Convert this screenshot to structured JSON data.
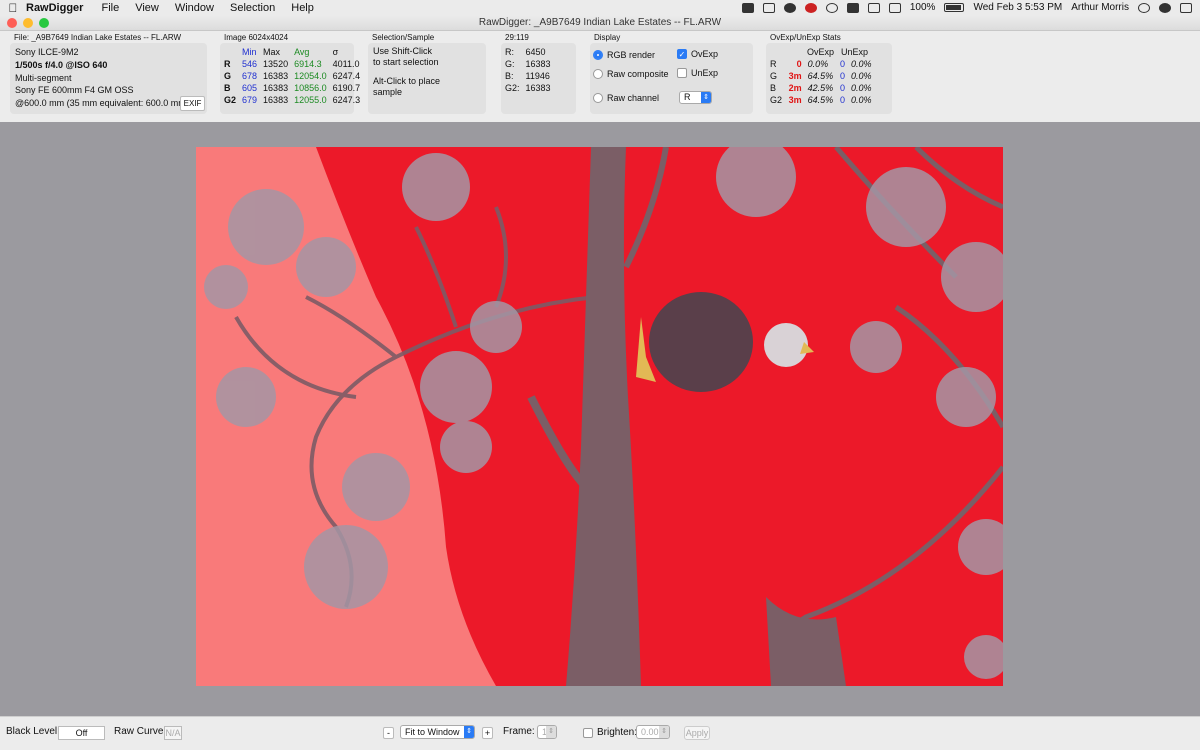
{
  "menubar": {
    "apple": "",
    "app": "RawDigger",
    "items": [
      "File",
      "View",
      "Window",
      "Selection",
      "Help"
    ],
    "battery": "100%",
    "datetime": "Wed Feb 3  5:53 PM",
    "user": "Arthur Morris"
  },
  "window": {
    "title": "RawDigger: _A9B7649  Indian Lake Estates -- FL.ARW"
  },
  "file": {
    "label": "File: _A9B7649  Indian Lake Estates -- FL.ARW",
    "camera": "Sony ILCE-9M2",
    "exposure": "1/500s f/4.0 @ISO 640",
    "mode": "Multi-segment",
    "lens": "Sony FE 600mm F4 GM OSS",
    "focal": "@600.0 mm (35 mm equivalent: 600.0 mm)",
    "exif_button": "EXIF"
  },
  "image_stats": {
    "label": "Image 6024x4024",
    "headers": [
      "",
      "Min",
      "Max",
      "Avg",
      "σ"
    ],
    "rows": [
      {
        "ch": "R",
        "min": "546",
        "max": "13520",
        "avg": "6914.3",
        "sigma": "4011.0"
      },
      {
        "ch": "G",
        "min": "678",
        "max": "16383",
        "avg": "12054.0",
        "sigma": "6247.4"
      },
      {
        "ch": "B",
        "min": "605",
        "max": "16383",
        "avg": "10856.0",
        "sigma": "6190.7"
      },
      {
        "ch": "G2",
        "min": "679",
        "max": "16383",
        "avg": "12055.0",
        "sigma": "6247.3"
      }
    ]
  },
  "selection": {
    "label": "Selection/Sample",
    "line1": "Use Shift-Click",
    "line2": "to start selection",
    "line3": "Alt-Click to place",
    "line4": "sample"
  },
  "sample": {
    "label": "29:119",
    "rows": [
      {
        "ch": "R:",
        "val": "6450"
      },
      {
        "ch": "G:",
        "val": "16383"
      },
      {
        "ch": "B:",
        "val": "11946"
      },
      {
        "ch": "G2:",
        "val": "16383"
      }
    ]
  },
  "display": {
    "label": "Display",
    "rgb_render": "RGB render",
    "raw_composite": "Raw composite",
    "raw_channel": "Raw channel",
    "ovexp": "OvExp",
    "unexp": "UnExp",
    "channel_value": "R",
    "selected_mode": "RGB render",
    "ovexp_checked": true,
    "unexp_checked": false
  },
  "ovexp_stats": {
    "label": "OvExp/UnExp Stats",
    "headers": [
      "",
      "OvExp",
      "",
      "UnExp",
      ""
    ],
    "rows": [
      {
        "ch": "R",
        "ov_count": "0",
        "ov_pct": "0.0%",
        "un_count": "0",
        "un_pct": "0.0%"
      },
      {
        "ch": "G",
        "ov_count": "3m",
        "ov_pct": "64.5%",
        "un_count": "0",
        "un_pct": "0.0%"
      },
      {
        "ch": "B",
        "ov_count": "2m",
        "ov_pct": "42.5%",
        "un_count": "0",
        "un_pct": "0.0%"
      },
      {
        "ch": "G2",
        "ov_count": "3m",
        "ov_pct": "64.5%",
        "un_count": "0",
        "un_pct": "0.0%"
      }
    ]
  },
  "bottom": {
    "black_level_label": "Black Level:",
    "black_level_value": "Off",
    "raw_curve_label": "Raw Curve:",
    "raw_curve_value": "N/A",
    "zoom_minus": "-",
    "zoom_value": "Fit to Window",
    "zoom_plus": "+",
    "frame_label": "Frame:",
    "frame_value": "1",
    "brighten_label": "Brighten:",
    "brighten_value": "0.00",
    "apply_label": "Apply"
  },
  "colors": {
    "overexposed_red": "#ec1929",
    "overexposed_light": "#f97a7a",
    "accent_blue": "#2a7bf5"
  }
}
